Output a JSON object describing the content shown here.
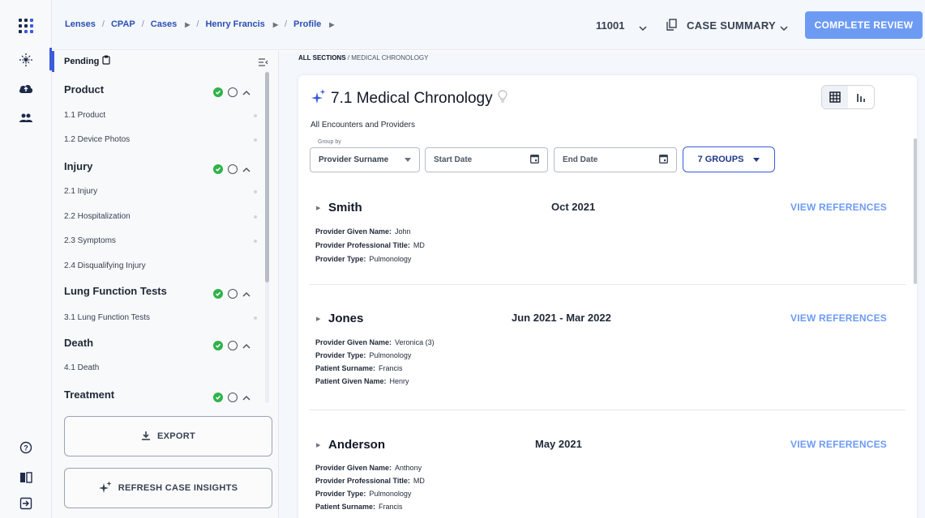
{
  "nav": {
    "breadcrumbs": [
      "Lenses",
      "CPAP",
      "Cases",
      "Henry Francis",
      "Profile"
    ],
    "case_number": "11001",
    "case_summary_label": "CASE SUMMARY",
    "complete_review_label": "COMPLETE REVIEW"
  },
  "sidebar": {
    "pending_label": "Pending",
    "sections": [
      {
        "title": "Product",
        "items": [
          "1.1  Product",
          "1.2  Device Photos"
        ]
      },
      {
        "title": "Injury",
        "items": [
          "2.1  Injury",
          "2.2  Hospitalization",
          "2.3  Symptoms",
          "2.4  Disqualifying Injury"
        ]
      },
      {
        "title": "Lung Function Tests",
        "items": [
          "3.1  Lung Function Tests"
        ]
      },
      {
        "title": "Death",
        "items": [
          "4.1  Death"
        ]
      },
      {
        "title": "Treatment",
        "items": []
      }
    ],
    "export_label": "EXPORT",
    "refresh_label": "REFRESH CASE INSIGHTS"
  },
  "main": {
    "breadcrumb_root": "ALL SECTIONS",
    "breadcrumb_current": "MEDICAL CHRONOLOGY",
    "title": "7.1 Medical Chronology",
    "subtitle": "All Encounters and Providers",
    "group_by_label": "Group by",
    "group_by_value": "Provider Surname",
    "start_date_placeholder": "Start Date",
    "end_date_placeholder": "End Date",
    "groups_label": "7 GROUPS",
    "view_references_label": "VIEW REFERENCES",
    "groups": [
      {
        "name": "Smith",
        "date": "Oct 2021",
        "details": [
          {
            "label": "Provider Given Name:",
            "value": "John"
          },
          {
            "label": "Provider Professional Title:",
            "value": "MD"
          },
          {
            "label": "Provider Type:",
            "value": "Pulmonology"
          }
        ]
      },
      {
        "name": "Jones",
        "date": "Jun 2021 - Mar 2022",
        "details": [
          {
            "label": "Provider Given Name:",
            "value": "Veronica (3)"
          },
          {
            "label": "Provider Type:",
            "value": "Pulmonology"
          },
          {
            "label": "Patient Surname:",
            "value": "Francis"
          },
          {
            "label": "Patient Given Name:",
            "value": "Henry"
          }
        ]
      },
      {
        "name": "Anderson",
        "date": "May 2021",
        "details": [
          {
            "label": "Provider Given Name:",
            "value": "Anthony"
          },
          {
            "label": "Provider Professional Title:",
            "value": "MD"
          },
          {
            "label": "Provider Type:",
            "value": "Pulmonology"
          },
          {
            "label": "Patient Surname:",
            "value": "Francis"
          }
        ]
      }
    ]
  },
  "icons": {
    "rail": [
      "app-grid-icon",
      "sparkle-icon",
      "cloud-upload-icon",
      "users-icon",
      "help-icon",
      "book-icon",
      "logout-icon"
    ]
  },
  "colors": {
    "accent": "#3b5bdb",
    "link": "#2b4fb4",
    "button": "#6d9bf4",
    "success": "#2fb34a"
  }
}
